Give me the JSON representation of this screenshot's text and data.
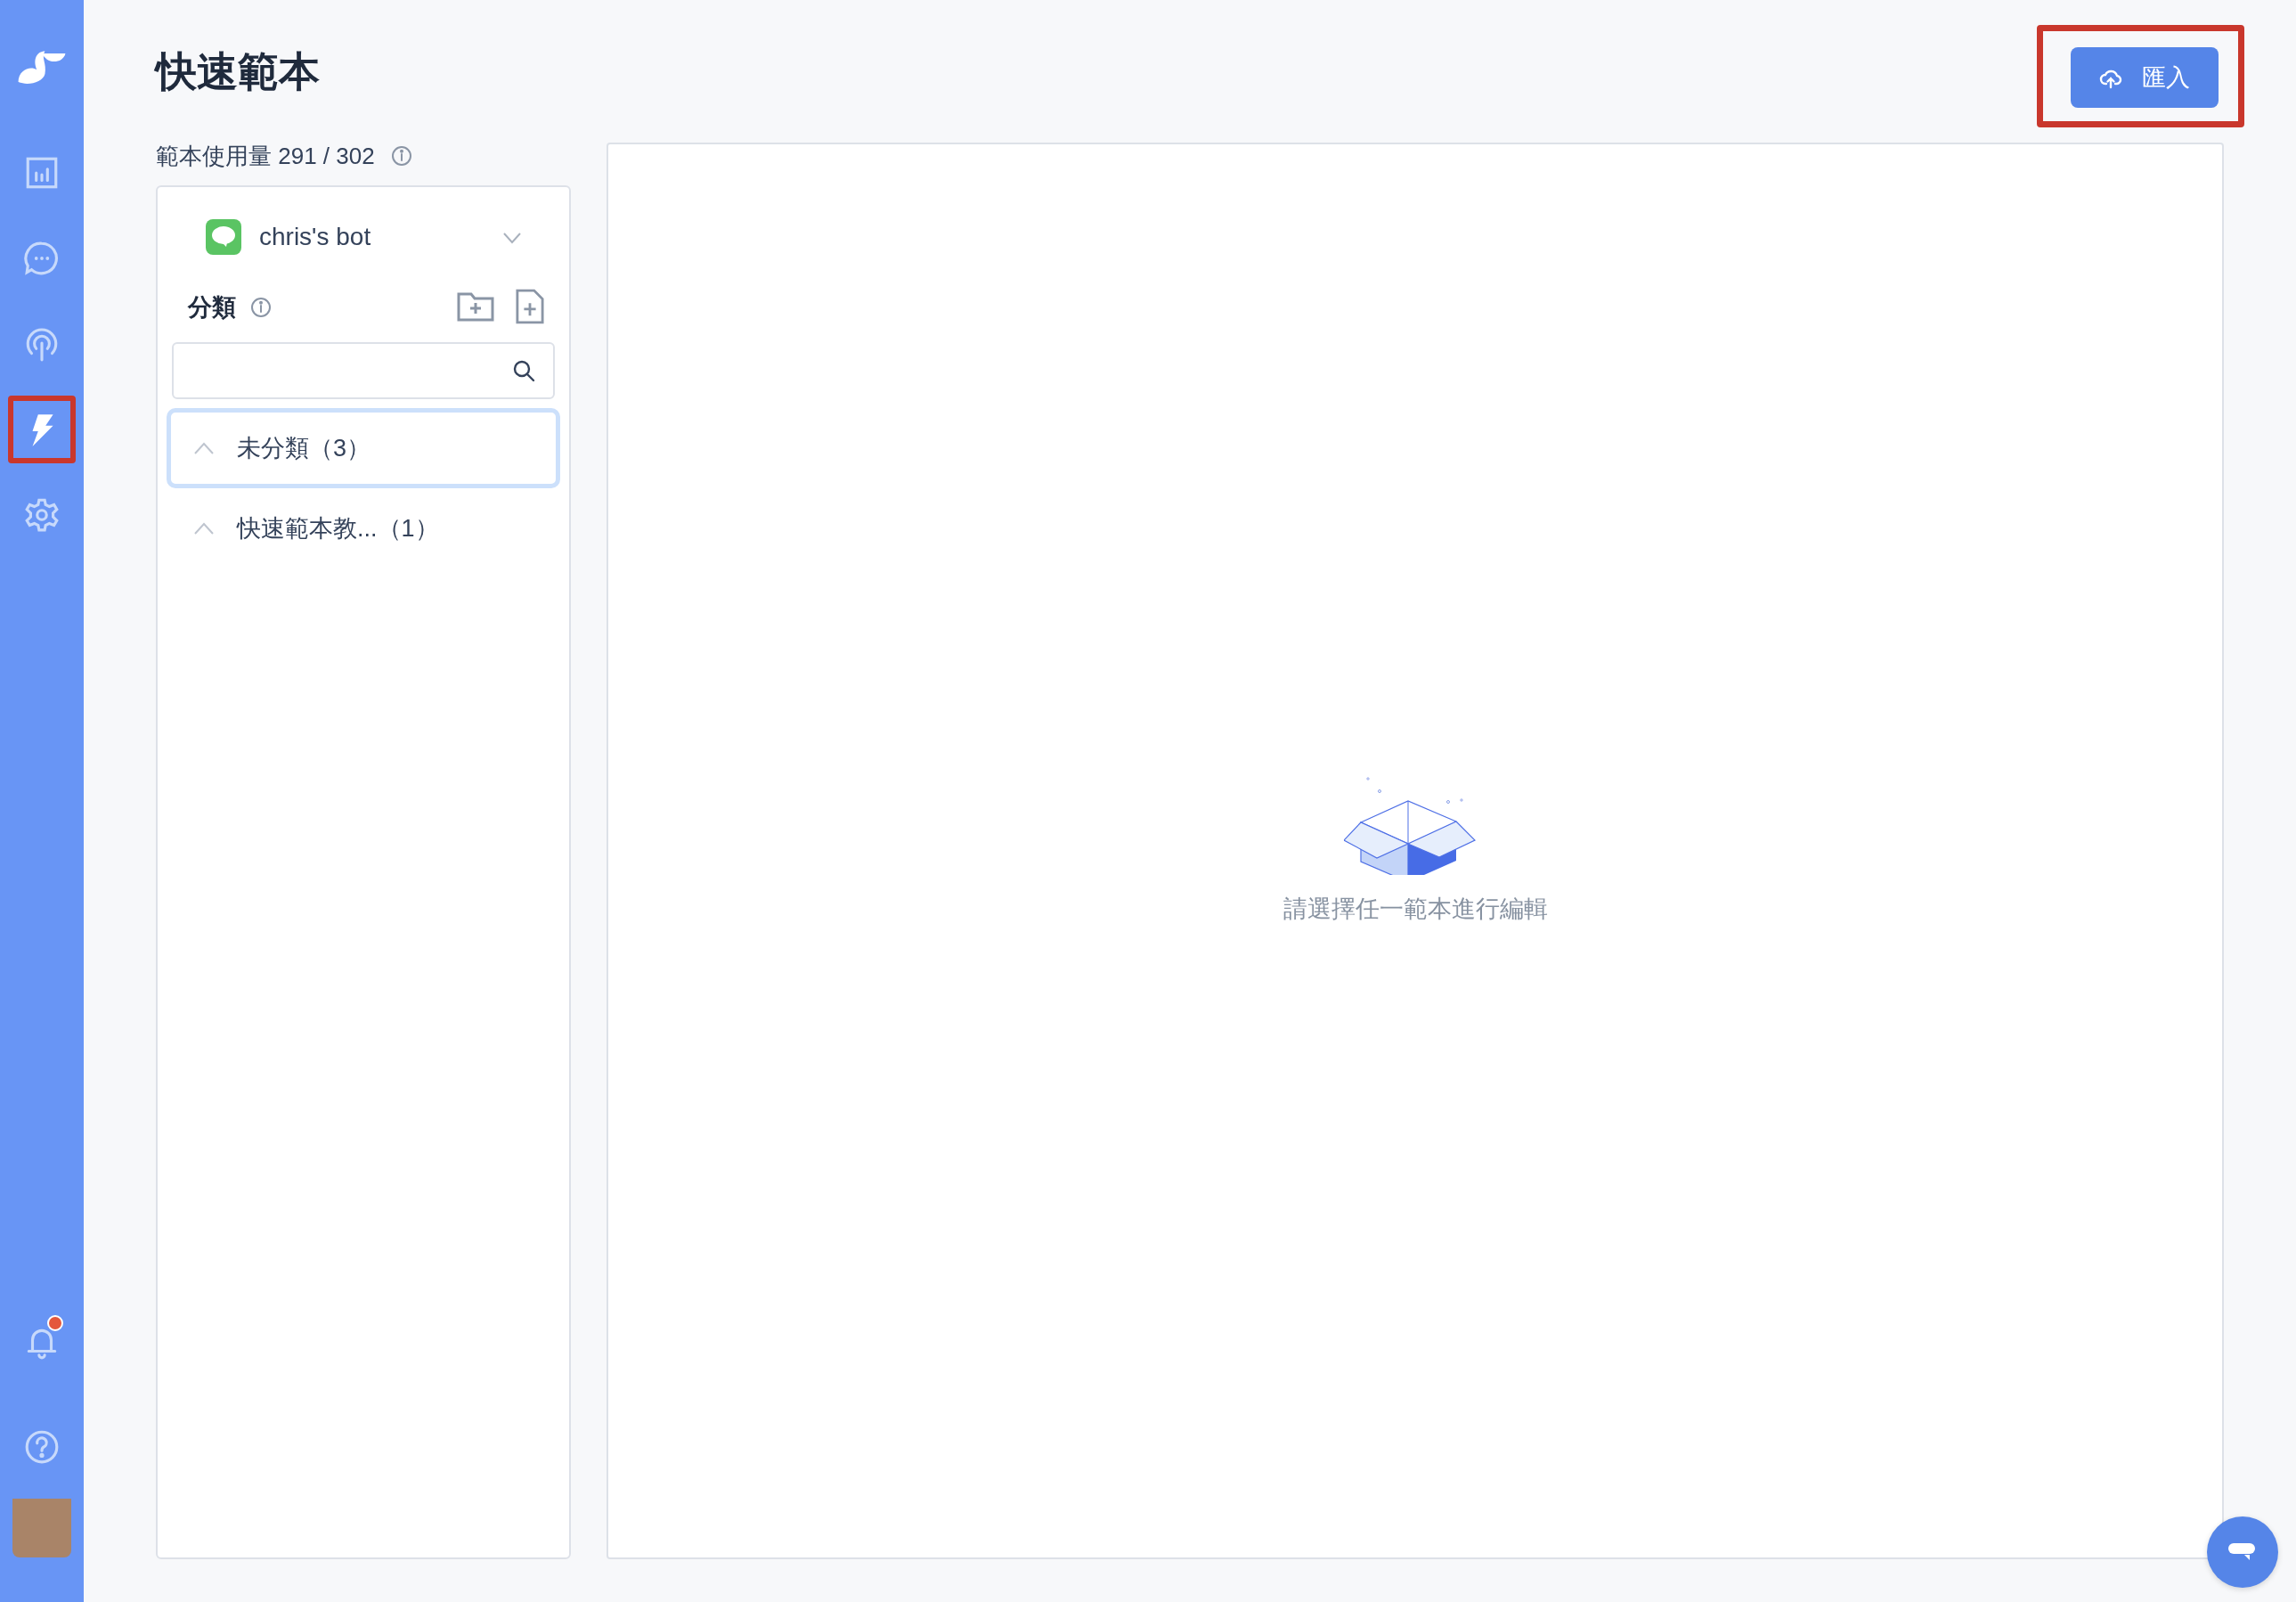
{
  "sidebar": {
    "top_items": [
      {
        "kind": "logo"
      },
      {
        "kind": "chart",
        "selected": false,
        "highlighted": false
      },
      {
        "kind": "chat",
        "selected": false,
        "highlighted": false
      },
      {
        "kind": "broadcast",
        "selected": false,
        "highlighted": false
      },
      {
        "kind": "bolt",
        "selected": true,
        "highlighted": true
      },
      {
        "kind": "gear",
        "selected": false,
        "highlighted": false
      }
    ],
    "bottom_items": [
      {
        "kind": "bell",
        "unread": true
      },
      {
        "kind": "help"
      },
      {
        "kind": "avatar"
      }
    ]
  },
  "page": {
    "title": "快速範本",
    "import_button": {
      "label": "匯入",
      "highlighted": true
    }
  },
  "usage": {
    "text": "範本使用量 291 / 302"
  },
  "category_panel": {
    "bot": {
      "name": "chris's bot"
    },
    "heading": "分類",
    "categories": [
      {
        "label": "未分類（3）",
        "selected": true
      },
      {
        "label": "快速範本教...（1）",
        "selected": false
      }
    ]
  },
  "editor": {
    "empty_message": "請選擇任一範本進行編輯"
  }
}
